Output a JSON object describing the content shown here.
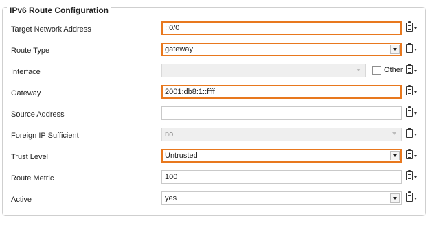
{
  "section_title": "IPv6 Route Configuration",
  "fields": {
    "target_network_address": {
      "label": "Target Network Address",
      "value": "::0/0"
    },
    "route_type": {
      "label": "Route Type",
      "value": "gateway"
    },
    "interface": {
      "label": "Interface",
      "value": "",
      "other_label": "Other"
    },
    "gateway": {
      "label": "Gateway",
      "value": "2001:db8:1::ffff"
    },
    "source_address": {
      "label": "Source Address",
      "value": ""
    },
    "foreign_ip_sufficient": {
      "label": "Foreign IP Sufficient",
      "value": "no"
    },
    "trust_level": {
      "label": "Trust Level",
      "value": "Untrusted"
    },
    "route_metric": {
      "label": "Route Metric",
      "value": "100"
    },
    "active": {
      "label": "Active",
      "value": "yes"
    }
  },
  "colors": {
    "highlight": "#e8781e",
    "border": "#c9c9c9",
    "disabled_bg": "#efefef"
  },
  "icons": {
    "row_menu": "clipboard-menu-icon",
    "dropdown": "chevron-down-icon"
  }
}
